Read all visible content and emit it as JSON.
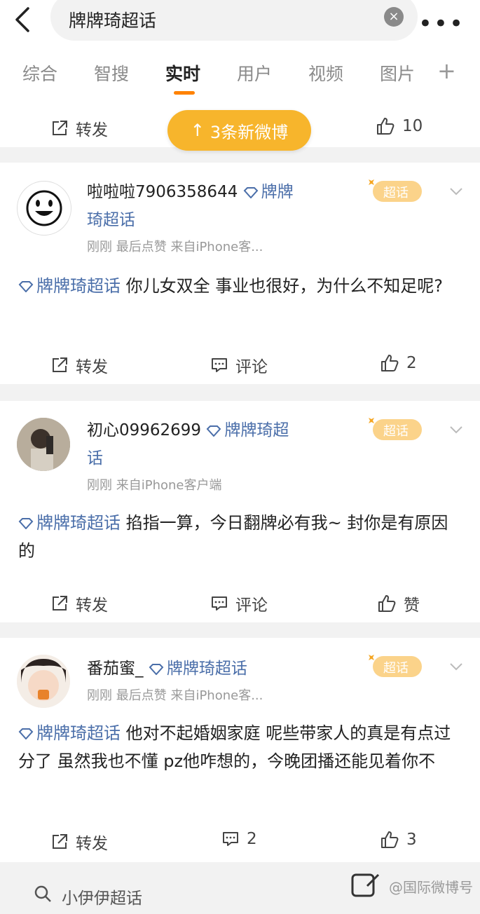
{
  "header": {
    "search_query": "牌牌琦超话",
    "clear_symbol": "×",
    "more_symbol": "•••"
  },
  "tabs": [
    {
      "label": "综合",
      "active": false
    },
    {
      "label": "智搜",
      "active": false
    },
    {
      "label": "实时",
      "active": true
    },
    {
      "label": "用户",
      "active": false
    },
    {
      "label": "视频",
      "active": false
    },
    {
      "label": "图片",
      "active": false
    }
  ],
  "tab_plus": "+",
  "first_actions": {
    "repost": "转发",
    "like_count": "10"
  },
  "new_posts_banner": "3条新微博",
  "posts": [
    {
      "name": "啦啦啦7906358644",
      "name_topic": "牌牌",
      "name_topic_cont": "琦超话",
      "meta": "刚刚  最后点赞  来自iPhone客...",
      "badge": "超话",
      "topic": "牌牌琦超话",
      "text": "你儿女双全 事业也很好，为什么不知足呢?",
      "actions": {
        "repost": "转发",
        "comment": "评论",
        "like": "2"
      }
    },
    {
      "name": "初心09962699",
      "name_topic": "牌牌琦超",
      "name_topic_cont": "话",
      "meta": "刚刚  来自iPhone客户端",
      "badge": "超话",
      "topic": "牌牌琦超话",
      "text": "掐指一算，今日翻牌必有我~ 封你是有原因的",
      "actions": {
        "repost": "转发",
        "comment": "评论",
        "like": "赞"
      }
    },
    {
      "name": "番茄蜜_",
      "name_topic": "牌牌琦超话",
      "name_topic_cont": "",
      "meta": "刚刚  最后点赞  来自iPhone客...",
      "badge": "超话",
      "topic": "牌牌琦超话",
      "text": "他对不起婚姻家庭 呢些带家人的真是有点过分了 虽然我也不懂 pz他咋想的，今晚团播还能见着你不",
      "actions": {
        "repost": "转发",
        "comment": "2",
        "like": "3"
      }
    }
  ],
  "bottom_search": "小伊伊超话",
  "watermark": "@国际微博号",
  "colors": {
    "accent": "#ff8200",
    "banner": "#f7b52c",
    "link": "#4a6ea9"
  }
}
